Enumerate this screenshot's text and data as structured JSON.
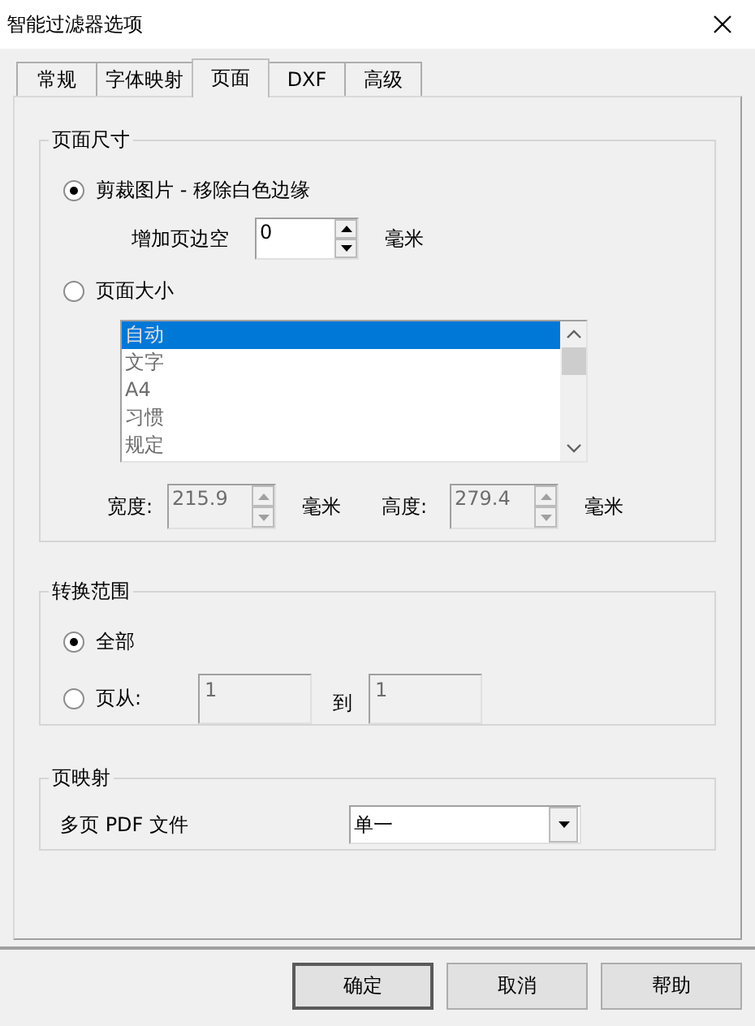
{
  "window": {
    "title": "智能过滤器选项"
  },
  "tabs": [
    {
      "label": "常规",
      "selected": false
    },
    {
      "label": "字体映射",
      "selected": false
    },
    {
      "label": "页面",
      "selected": true
    },
    {
      "label": "DXF",
      "selected": false
    },
    {
      "label": "高级",
      "selected": false
    }
  ],
  "page_size": {
    "title": "页面尺寸",
    "crop_option": {
      "label": "剪裁图片 - 移除白色边缘",
      "selected": true
    },
    "margin": {
      "label": "增加页边空",
      "value": "0",
      "unit": "毫米"
    },
    "size_option": {
      "label": "页面大小",
      "selected": false
    },
    "size_list": {
      "disabled": true,
      "items": [
        {
          "label": "自动",
          "selected": true
        },
        {
          "label": "文字",
          "selected": false
        },
        {
          "label": "A4",
          "selected": false
        },
        {
          "label": "习惯",
          "selected": false
        },
        {
          "label": "规定",
          "selected": false
        }
      ]
    },
    "width": {
      "label": "宽度:",
      "value": "215.9",
      "unit": "毫米",
      "disabled": true
    },
    "height": {
      "label": "高度:",
      "value": "279.4",
      "unit": "毫米",
      "disabled": true
    }
  },
  "range": {
    "title": "转换范围",
    "options": [
      {
        "label": "全部",
        "selected": true
      },
      {
        "label": "页从:",
        "selected": false
      }
    ],
    "from": {
      "value": "1",
      "disabled": true
    },
    "to_label": "到",
    "to": {
      "value": "1",
      "disabled": true
    }
  },
  "mapping": {
    "title": "页映射",
    "label": "多页 PDF 文件",
    "value": "单一"
  },
  "buttons": [
    "确定",
    "取消",
    "帮助"
  ]
}
